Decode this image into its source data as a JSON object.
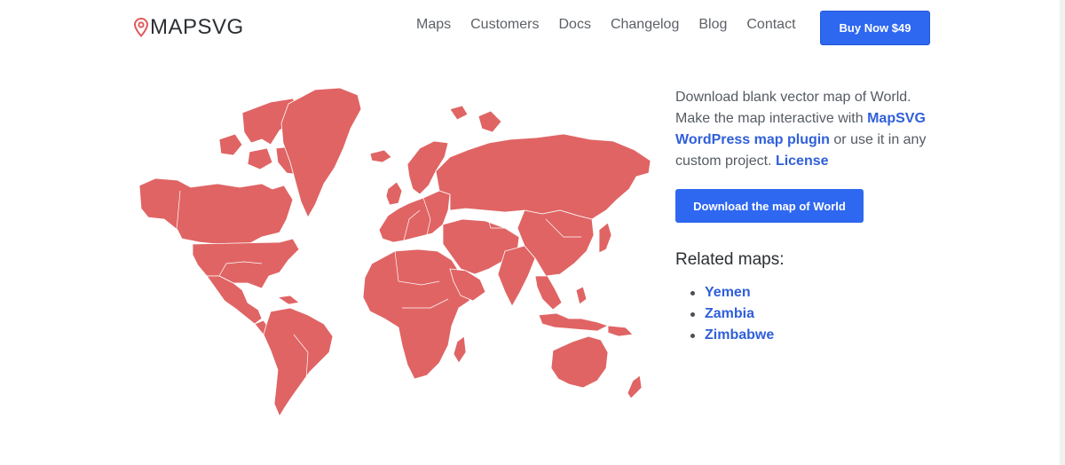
{
  "brand": {
    "name": "MAPSVG",
    "accent": "#e05a5a"
  },
  "nav": {
    "items": [
      "Maps",
      "Customers",
      "Docs",
      "Changelog",
      "Blog",
      "Contact"
    ]
  },
  "header": {
    "buy_label": "Buy Now $49"
  },
  "description": {
    "part1": "Download blank vector map of World. Make the map interactive with ",
    "plugin_link": "MapSVG WordPress map plugin",
    "part2": " or use it in any custom project. ",
    "license_link": "License"
  },
  "download": {
    "label": "Download the map of World"
  },
  "related": {
    "title": "Related maps:",
    "items": [
      "Yemen",
      "Zambia",
      "Zimbabwe"
    ]
  },
  "colors": {
    "primary": "#2e67f0",
    "map_fill": "#e06464",
    "link": "#2f5fd9"
  }
}
